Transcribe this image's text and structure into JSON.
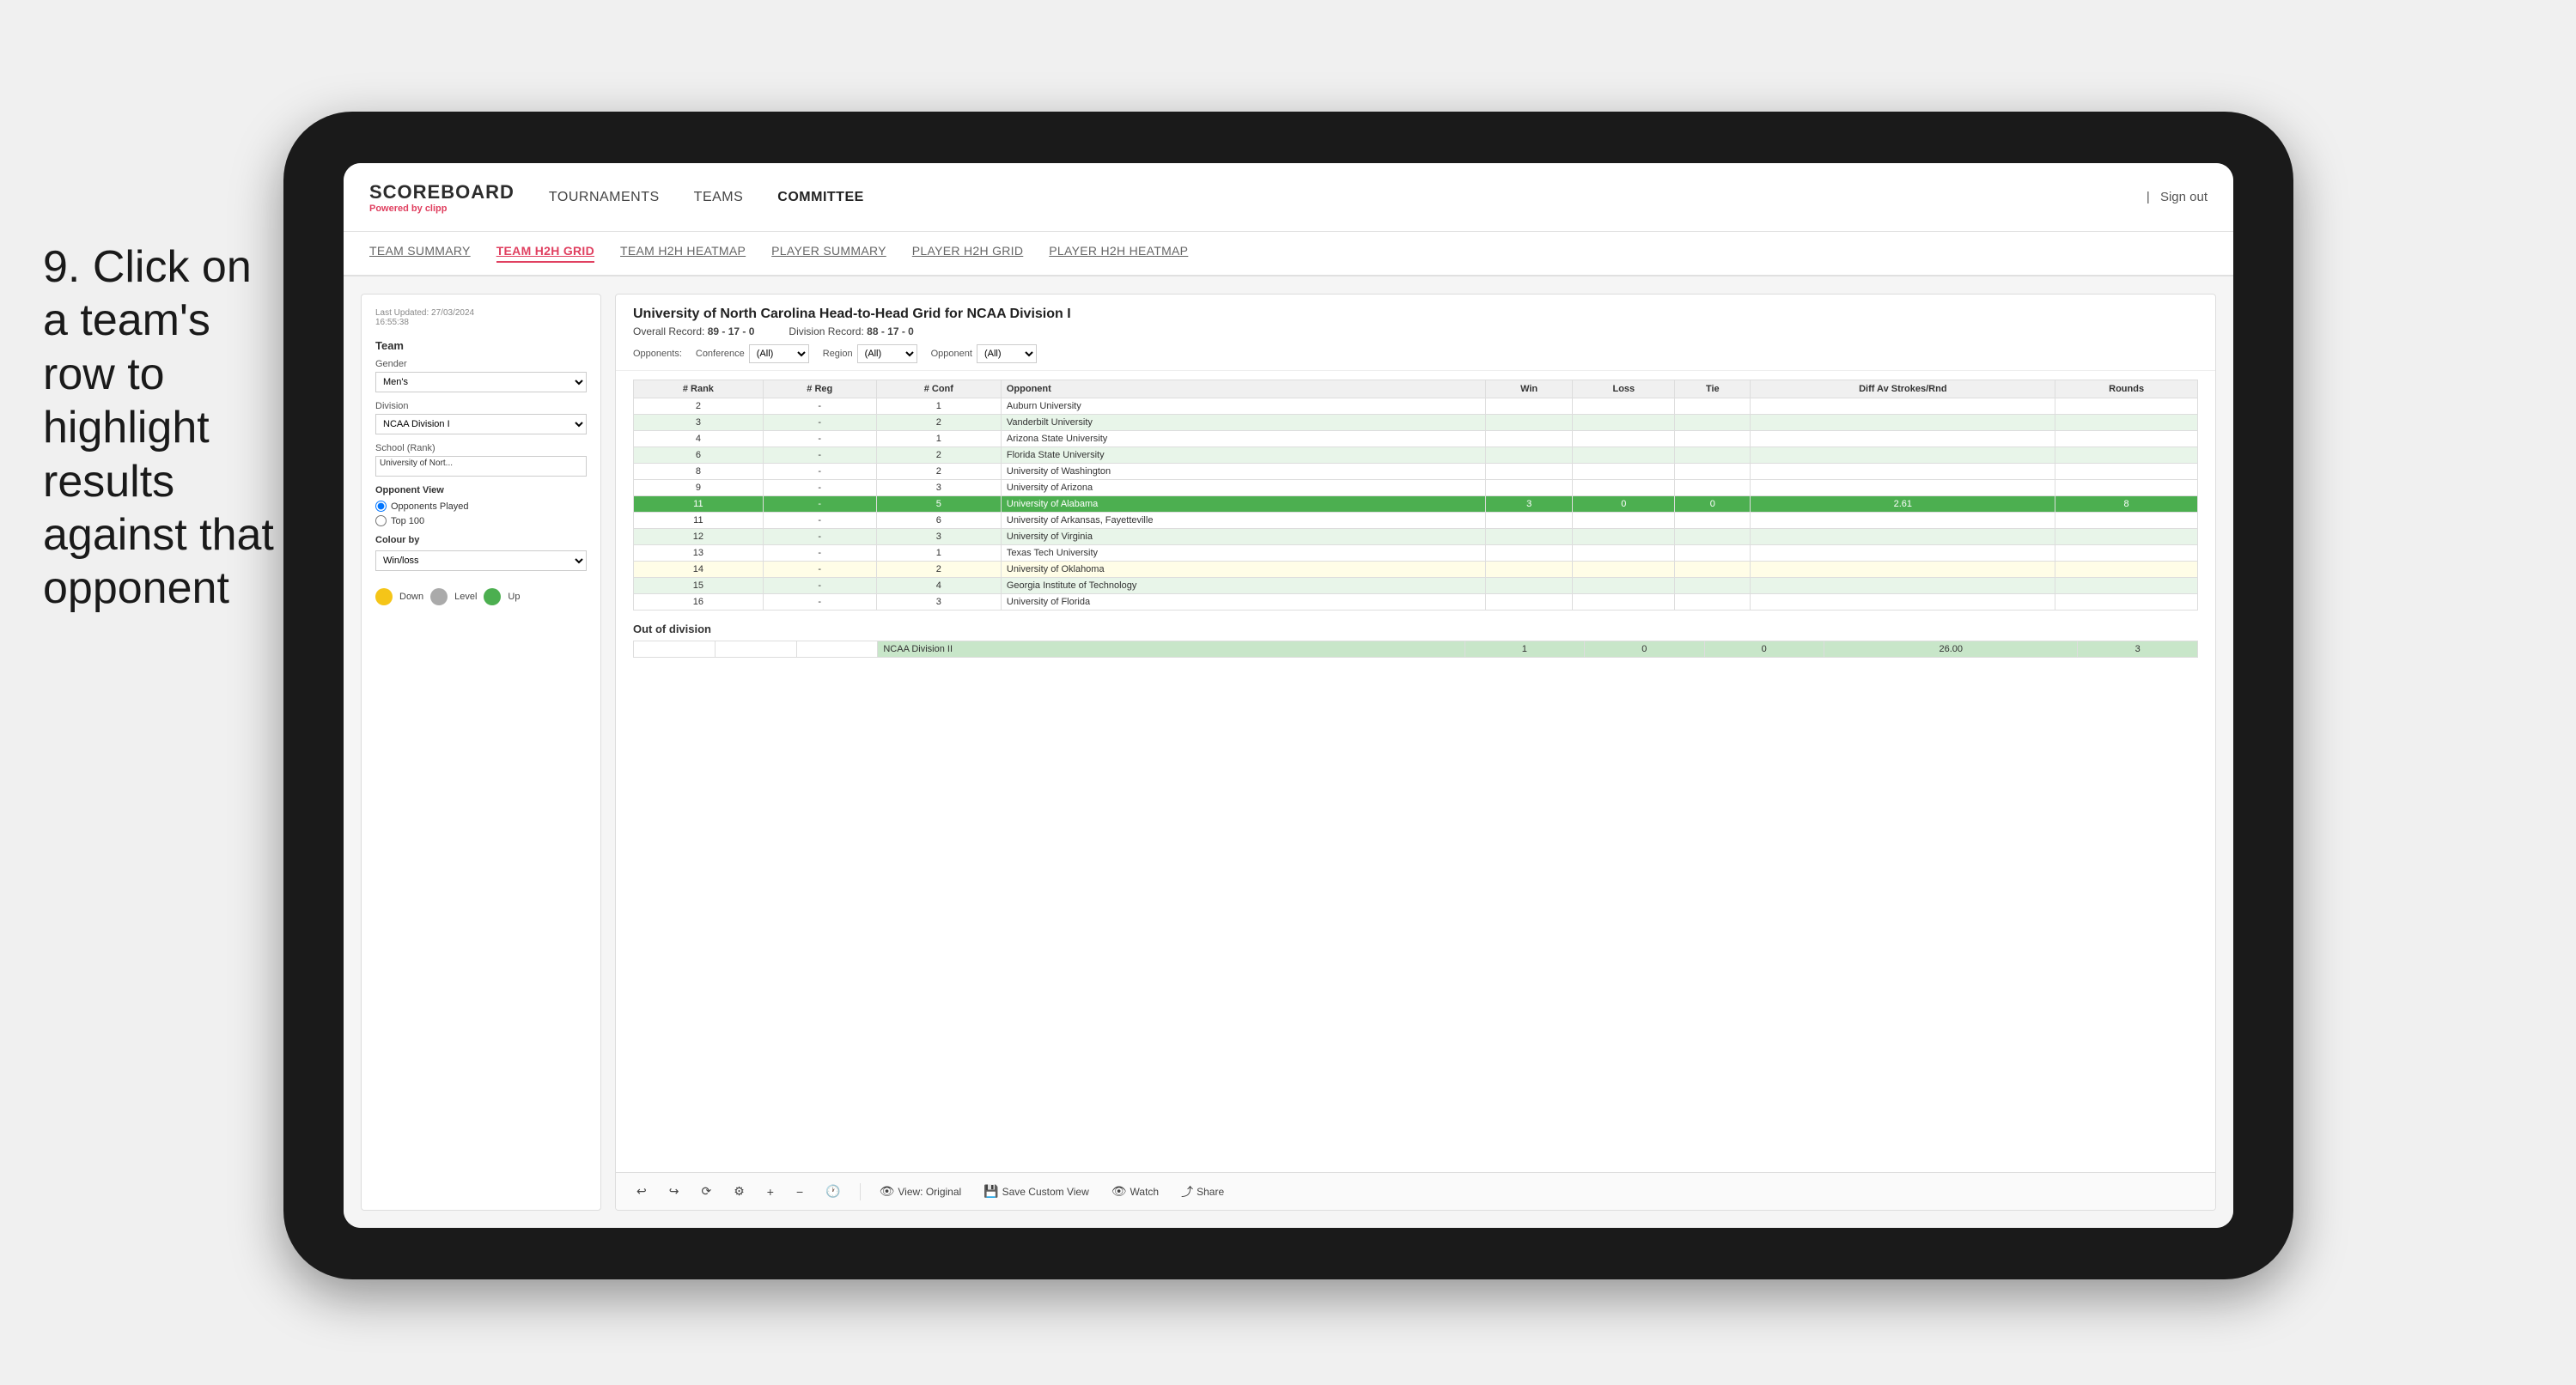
{
  "instruction": {
    "step": "9.",
    "text": "Click on a team's row to highlight results against that opponent"
  },
  "nav": {
    "logo": "SCOREBOARD",
    "powered_by": "Powered by",
    "brand": "clipp",
    "links": [
      "TOURNAMENTS",
      "TEAMS",
      "COMMITTEE"
    ],
    "sign_out": "Sign out"
  },
  "sub_nav": {
    "links": [
      "TEAM SUMMARY",
      "TEAM H2H GRID",
      "TEAM H2H HEATMAP",
      "PLAYER SUMMARY",
      "PLAYER H2H GRID",
      "PLAYER H2H HEATMAP"
    ],
    "active": "TEAM H2H GRID"
  },
  "sidebar": {
    "last_updated": "Last Updated: 27/03/2024",
    "last_updated_time": "16:55:38",
    "team_label": "Team",
    "gender_label": "Gender",
    "gender_value": "Men's",
    "division_label": "Division",
    "division_value": "NCAA Division I",
    "school_label": "School (Rank)",
    "school_value": "University of Nort...",
    "opponent_view_label": "Opponent View",
    "radio_options": [
      "Opponents Played",
      "Top 100"
    ],
    "colour_by_label": "Colour by",
    "colour_by_value": "Win/loss",
    "legend": [
      {
        "color": "#f5c518",
        "label": "Down"
      },
      {
        "color": "#aaaaaa",
        "label": "Level"
      },
      {
        "color": "#4caf50",
        "label": "Up"
      }
    ]
  },
  "data_panel": {
    "title": "University of North Carolina Head-to-Head Grid for NCAA Division I",
    "overall_record_label": "Overall Record:",
    "overall_record": "89 - 17 - 0",
    "division_record_label": "Division Record:",
    "division_record": "88 - 17 - 0",
    "filters": {
      "opponents_label": "Opponents:",
      "conference_label": "Conference",
      "conference_value": "(All)",
      "region_label": "Region",
      "region_value": "(All)",
      "opponent_label": "Opponent",
      "opponent_value": "(All)"
    },
    "columns": [
      "# Rank",
      "# Reg",
      "# Conf",
      "Opponent",
      "Win",
      "Loss",
      "Tie",
      "Diff Av Strokes/Rnd",
      "Rounds"
    ],
    "rows": [
      {
        "rank": "2",
        "reg": "-",
        "conf": "1",
        "opponent": "Auburn University",
        "win": "",
        "loss": "",
        "tie": "",
        "diff": "",
        "rounds": "",
        "highlight": false,
        "row_style": "normal"
      },
      {
        "rank": "3",
        "reg": "-",
        "conf": "2",
        "opponent": "Vanderbilt University",
        "win": "",
        "loss": "",
        "tie": "",
        "diff": "",
        "rounds": "",
        "highlight": false,
        "row_style": "green-light"
      },
      {
        "rank": "4",
        "reg": "-",
        "conf": "1",
        "opponent": "Arizona State University",
        "win": "",
        "loss": "",
        "tie": "",
        "diff": "",
        "rounds": "",
        "highlight": false,
        "row_style": "normal"
      },
      {
        "rank": "6",
        "reg": "-",
        "conf": "2",
        "opponent": "Florida State University",
        "win": "",
        "loss": "",
        "tie": "",
        "diff": "",
        "rounds": "",
        "highlight": false,
        "row_style": "green-light"
      },
      {
        "rank": "8",
        "reg": "-",
        "conf": "2",
        "opponent": "University of Washington",
        "win": "",
        "loss": "",
        "tie": "",
        "diff": "",
        "rounds": "",
        "highlight": false,
        "row_style": "normal"
      },
      {
        "rank": "9",
        "reg": "-",
        "conf": "3",
        "opponent": "University of Arizona",
        "win": "",
        "loss": "",
        "tie": "",
        "diff": "",
        "rounds": "",
        "highlight": false,
        "row_style": "normal"
      },
      {
        "rank": "11",
        "reg": "-",
        "conf": "5",
        "opponent": "University of Alabama",
        "win": "3",
        "loss": "0",
        "tie": "0",
        "diff": "2.61",
        "rounds": "8",
        "highlight": true,
        "row_style": "highlighted"
      },
      {
        "rank": "11",
        "reg": "-",
        "conf": "6",
        "opponent": "University of Arkansas, Fayetteville",
        "win": "",
        "loss": "",
        "tie": "",
        "diff": "",
        "rounds": "",
        "highlight": false,
        "row_style": "normal"
      },
      {
        "rank": "12",
        "reg": "-",
        "conf": "3",
        "opponent": "University of Virginia",
        "win": "",
        "loss": "",
        "tie": "",
        "diff": "",
        "rounds": "",
        "highlight": false,
        "row_style": "green-light"
      },
      {
        "rank": "13",
        "reg": "-",
        "conf": "1",
        "opponent": "Texas Tech University",
        "win": "",
        "loss": "",
        "tie": "",
        "diff": "",
        "rounds": "",
        "highlight": false,
        "row_style": "normal"
      },
      {
        "rank": "14",
        "reg": "-",
        "conf": "2",
        "opponent": "University of Oklahoma",
        "win": "",
        "loss": "",
        "tie": "",
        "diff": "",
        "rounds": "",
        "highlight": false,
        "row_style": "yellow"
      },
      {
        "rank": "15",
        "reg": "-",
        "conf": "4",
        "opponent": "Georgia Institute of Technology",
        "win": "",
        "loss": "",
        "tie": "",
        "diff": "",
        "rounds": "",
        "highlight": false,
        "row_style": "green-light"
      },
      {
        "rank": "16",
        "reg": "-",
        "conf": "3",
        "opponent": "University of Florida",
        "win": "",
        "loss": "",
        "tie": "",
        "diff": "",
        "rounds": "",
        "highlight": false,
        "row_style": "normal"
      }
    ],
    "out_of_division_label": "Out of division",
    "out_of_division_row": {
      "label": "NCAA Division II",
      "win": "1",
      "loss": "0",
      "tie": "0",
      "diff": "26.00",
      "rounds": "3"
    }
  },
  "toolbar": {
    "view_label": "View: Original",
    "save_label": "Save Custom View",
    "watch_label": "Watch",
    "share_label": "Share"
  }
}
